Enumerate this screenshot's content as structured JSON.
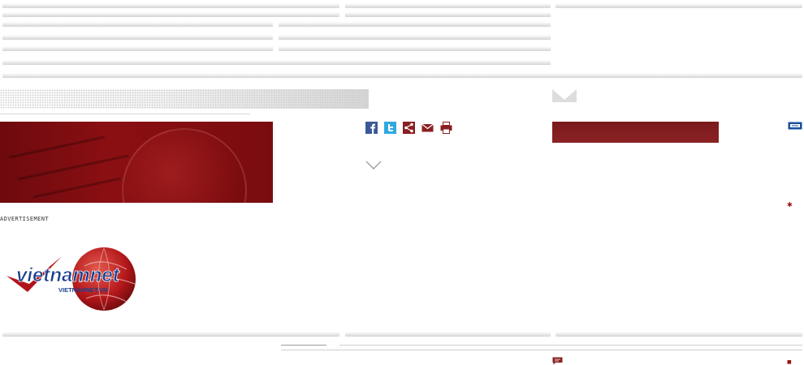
{
  "advertisement": {
    "label": "ADVERTISEMENT"
  },
  "logo": {
    "wordmark": "vietnamnet",
    "url_text": "VIETNAMNET.VN"
  },
  "share_icons": [
    "facebook-icon",
    "twitter-icon",
    "share-icon",
    "email-icon",
    "print-icon"
  ],
  "colors": {
    "brand_red": "#8a0f12",
    "panel_red": "#822022",
    "link_blue": "#1a4f9c",
    "bar_gray": "#d4d4d4"
  }
}
